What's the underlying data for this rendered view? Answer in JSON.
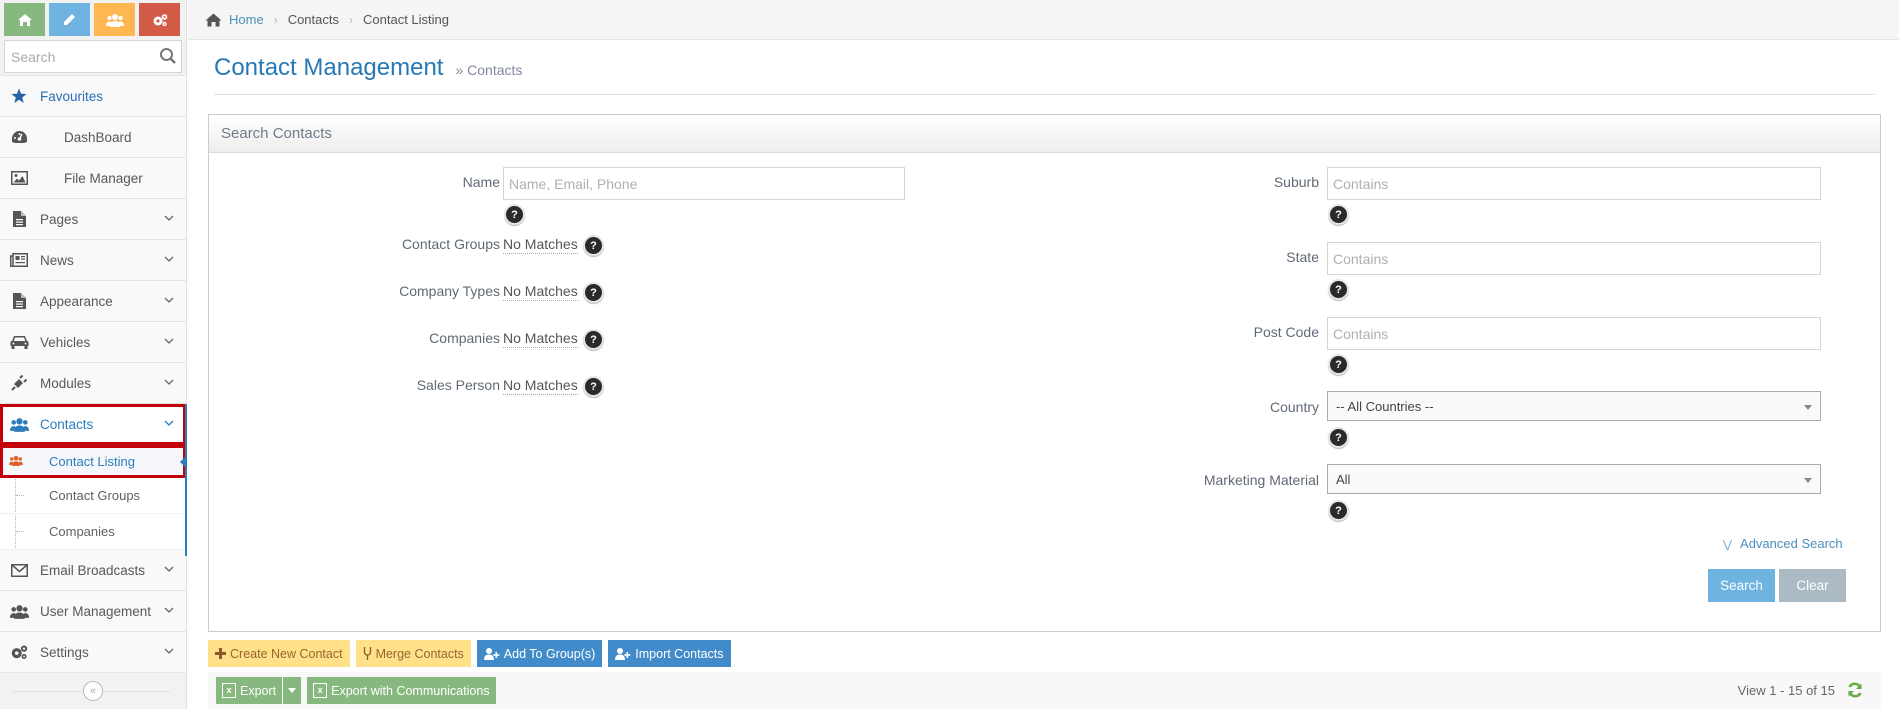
{
  "sidebar": {
    "shortcuts": [
      {
        "name": "home-shortcut",
        "icon": "home-icon",
        "color": "#87b87f"
      },
      {
        "name": "edit-shortcut",
        "icon": "pencil-icon",
        "color": "#6fb3e0"
      },
      {
        "name": "users-shortcut",
        "icon": "users-icon",
        "color": "#ffb752"
      },
      {
        "name": "settings-shortcut",
        "icon": "cogs-icon",
        "color": "#d15b47"
      }
    ],
    "search_placeholder": "Search",
    "favourites": "Favourites",
    "items": [
      {
        "label": "DashBoard",
        "icon": "dashboard-icon"
      },
      {
        "label": "File Manager",
        "icon": "picture-icon"
      },
      {
        "label": "Pages",
        "icon": "file-icon"
      },
      {
        "label": "News",
        "icon": "newspaper-icon"
      },
      {
        "label": "Appearance",
        "icon": "file-icon"
      },
      {
        "label": "Vehicles",
        "icon": "car-icon"
      },
      {
        "label": "Modules",
        "icon": "plug-icon"
      },
      {
        "label": "Contacts",
        "icon": "users-icon"
      },
      {
        "label": "Email Broadcasts",
        "icon": "envelope-icon"
      },
      {
        "label": "User Management",
        "icon": "users-icon"
      },
      {
        "label": "Settings",
        "icon": "cogs-icon"
      }
    ],
    "contacts_submenu": [
      {
        "label": "Contact Listing"
      },
      {
        "label": "Contact Groups"
      },
      {
        "label": "Companies"
      }
    ],
    "collapse_glyph": "«"
  },
  "breadcrumb": {
    "home": "Home",
    "items": [
      "Contacts",
      "Contact Listing"
    ],
    "separator": "›"
  },
  "header": {
    "title": "Contact Management",
    "subtitle": "» Contacts"
  },
  "search": {
    "title": "Search Contacts",
    "name_label": "Name",
    "name_placeholder": "Name, Email, Phone",
    "name_value": "",
    "contact_groups_label": "Contact Groups",
    "company_types_label": "Company Types",
    "companies_label": "Companies",
    "sales_person_label": "Sales Person",
    "no_matches": "No Matches",
    "suburb_label": "Suburb",
    "suburb_placeholder": "Contains",
    "state_label": "State",
    "state_placeholder": "Contains",
    "postcode_label": "Post Code",
    "postcode_placeholder": "Contains",
    "country_label": "Country",
    "country_value": "-- All Countries --",
    "marketing_label": "Marketing Material",
    "marketing_value": "All",
    "help_glyph": "?",
    "advanced_search": "Advanced Search",
    "search_button": "Search",
    "clear_button": "Clear"
  },
  "actions": {
    "create": "Create New Contact",
    "merge": "Merge Contacts",
    "add_to_group": "Add To Group(s)",
    "import": "Import Contacts"
  },
  "footer": {
    "export": "Export",
    "export_comm": "Export with Communications",
    "view_info": "View 1 - 15 of 15"
  },
  "colors": {
    "accent": "#2b7dbc",
    "highlight_box": "#c4000b",
    "export_green": "#87b87f",
    "action_yellow": "#fee188",
    "action_blue": "#428bca"
  }
}
